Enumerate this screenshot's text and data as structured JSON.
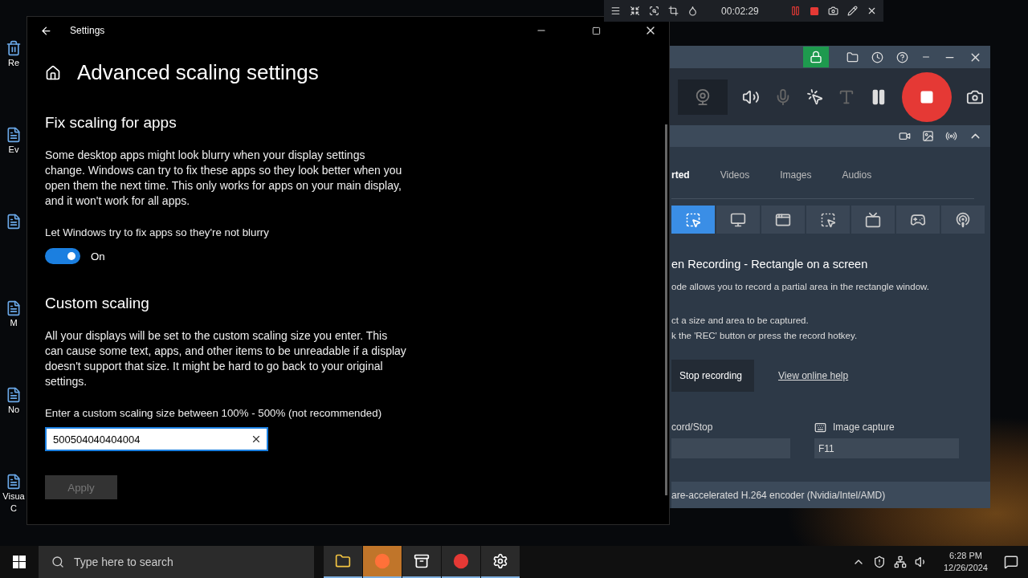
{
  "desktop_icons": [
    {
      "label": "Re",
      "kind": "bin"
    },
    {
      "label": "Ev",
      "kind": "shortcut"
    },
    {
      "kind": "shortcut"
    },
    {
      "label": "M",
      "kind": "shortcut"
    },
    {
      "label": "No",
      "kind": "shortcut"
    },
    {
      "label": "Visua",
      "label_2": "C",
      "kind": "shortcut"
    }
  ],
  "capture_bar": {
    "timer": "00:02:29"
  },
  "recorder": {
    "tabs": [
      {
        "label": "rted",
        "selected": true
      },
      {
        "label": "Videos",
        "selected": false
      },
      {
        "label": "Images",
        "selected": false
      },
      {
        "label": "Audios",
        "selected": false
      }
    ],
    "modes": [
      {
        "selected": true
      },
      {
        "selected": false
      },
      {
        "selected": false
      },
      {
        "selected": false
      },
      {
        "selected": false
      },
      {
        "selected": false
      },
      {
        "selected": false
      }
    ],
    "title": "en Recording - Rectangle on a screen",
    "description": "ode allows you to record a partial area in the rectangle window.",
    "steps": [
      "ct a size and area to be captured.",
      "k the 'REC' button or press the record hotkey."
    ],
    "stop_button": "Stop recording",
    "help_link": "View online help",
    "hotkeys": [
      {
        "label": "cord/Stop"
      },
      {
        "label": "Image capture",
        "value": "F11"
      }
    ],
    "encoder": "are-accelerated H.264 encoder (Nvidia/Intel/AMD)"
  },
  "settings": {
    "window_title": "Settings",
    "heading": "Advanced scaling settings",
    "fix_section": {
      "title": "Fix scaling for apps",
      "text": "Some desktop apps might look blurry when your display settings change. Windows can try to fix these apps so they look better when you open them the next time. This only works for apps on your main display, and it won't work for all apps.",
      "toggle_label": "Let Windows try to fix apps so they're not blurry",
      "toggle": {
        "on": true,
        "state_label": "On"
      }
    },
    "custom_section": {
      "title": "Custom scaling",
      "text": "All your displays will be set to the custom scaling size you enter. This can cause some text, apps, and other items to be unreadable if a display doesn't support that size. It might be hard to go back to your original settings.",
      "field_label": "Enter a custom scaling size between 100% - 500% (not recommended)",
      "field_value": "500504040404004",
      "apply_button": {
        "label": "Apply",
        "disabled": true
      }
    }
  },
  "taskbar": {
    "search_placeholder": "Type here to search",
    "apps": [
      {
        "kind": "explorer",
        "selected": false
      },
      {
        "kind": "firefox",
        "selected": true
      },
      {
        "kind": "archiver",
        "selected": false
      },
      {
        "kind": "recorder",
        "selected": false
      },
      {
        "kind": "settings",
        "selected": false
      }
    ],
    "time": "6:28 PM",
    "date": "12/26/2024"
  }
}
